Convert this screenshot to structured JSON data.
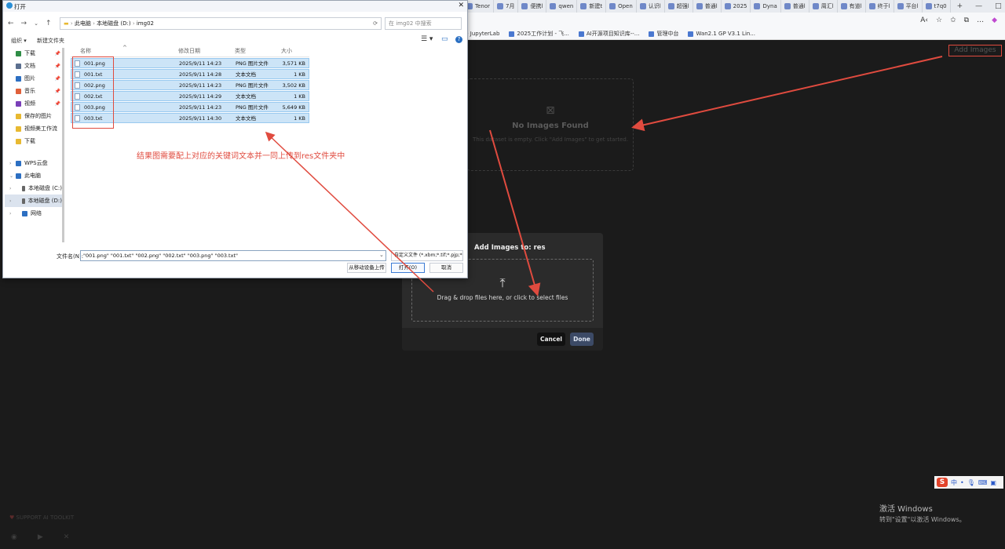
{
  "browser": {
    "tabs": [
      "Tenor",
      "7月",
      "便携l",
      "qwen",
      "新建t",
      "Open",
      "认识l",
      "超强l",
      "普通l",
      "2025",
      "Dyna",
      "普通l",
      "周汇l",
      "有道l",
      "终于l",
      "平台l",
      "t7q0"
    ],
    "bookmarks": [
      "- JupyterLab",
      "2025工作计划 - 飞...",
      "AI开源项目知识库--...",
      "管理中台",
      "Wan2.1 GP V3.1 Lin..."
    ]
  },
  "app": {
    "add_images_label": "Add Images",
    "empty_title": "No Images Found",
    "empty_sub": "This dataset is empty. Click \"Add Images\" to get started.",
    "modal": {
      "title": "Add Images to: res",
      "drop_text": "Drag & drop files here, or click to select files",
      "cancel": "Cancel",
      "done": "Done"
    },
    "footer_support": "SUPPORT AI TOOLKIT",
    "activate_title": "激活 Windows",
    "activate_sub": "转到\"设置\"以激活 Windows。",
    "ime_label": "中"
  },
  "dialog": {
    "title": "打开",
    "path": [
      "此电脑",
      "本地磁盘 (D:)",
      "img02"
    ],
    "search_placeholder": "在 img02 中搜索",
    "organize": "组织 ▾",
    "new_folder": "新建文件夹",
    "sidebar": [
      {
        "label": "下载",
        "pin": true,
        "color": "#2f8d46"
      },
      {
        "label": "文档",
        "pin": true,
        "color": "#5b6f8f"
      },
      {
        "label": "图片",
        "pin": true,
        "color": "#2c6fc2"
      },
      {
        "label": "音乐",
        "pin": true,
        "color": "#e0603a"
      },
      {
        "label": "视频",
        "pin": true,
        "color": "#7a3fb8"
      },
      {
        "label": "保存的图片",
        "pin": false,
        "color": "#e8b931"
      },
      {
        "label": "视频美工作流",
        "pin": false,
        "color": "#e8b931"
      },
      {
        "label": "下载",
        "pin": false,
        "color": "#e8b931"
      }
    ],
    "tree": [
      {
        "label": "WPS云盘",
        "caret": "›",
        "color": "#2c6fc2"
      },
      {
        "label": "此电脑",
        "caret": "⌄",
        "color": "#2c6fc2"
      },
      {
        "label": "本地磁盘 (C:)",
        "caret": "›",
        "color": "#666"
      },
      {
        "label": "本地磁盘 (D:)",
        "caret": "›",
        "color": "#666",
        "selected": true
      },
      {
        "label": "网络",
        "caret": "›",
        "color": "#2c6fc2"
      }
    ],
    "columns": [
      "名称",
      "修改日期",
      "类型",
      "大小"
    ],
    "files": [
      {
        "name": "001.png",
        "date": "2025/9/11 14:23",
        "type": "PNG 图片文件",
        "size": "3,571 KB"
      },
      {
        "name": "001.txt",
        "date": "2025/9/11 14:28",
        "type": "文本文档",
        "size": "1 KB"
      },
      {
        "name": "002.png",
        "date": "2025/9/11 14:23",
        "type": "PNG 图片文件",
        "size": "3,502 KB"
      },
      {
        "name": "002.txt",
        "date": "2025/9/11 14:29",
        "type": "文本文档",
        "size": "1 KB"
      },
      {
        "name": "003.png",
        "date": "2025/9/11 14:23",
        "type": "PNG 图片文件",
        "size": "5,649 KB"
      },
      {
        "name": "003.txt",
        "date": "2025/9/11 14:30",
        "type": "文本文档",
        "size": "1 KB"
      }
    ],
    "filename_label": "文件名(N):",
    "filename_value": "\"001.png\" \"001.txt\" \"002.png\" \"002.txt\" \"003.png\" \"003.txt\"",
    "filetype": "自定义文件 (*.xbm;*.tif;*.pjp;*.",
    "upload_mobile": "从移动设备上传",
    "open": "打开(O)",
    "cancel": "取消"
  },
  "annotation": "结果图需要配上对应的关键词文本并一同上传到res文件夹中",
  "colors": {
    "annotation": "#e04b3f",
    "selection": "#cce4f7",
    "done_button": "#3c4a66"
  }
}
